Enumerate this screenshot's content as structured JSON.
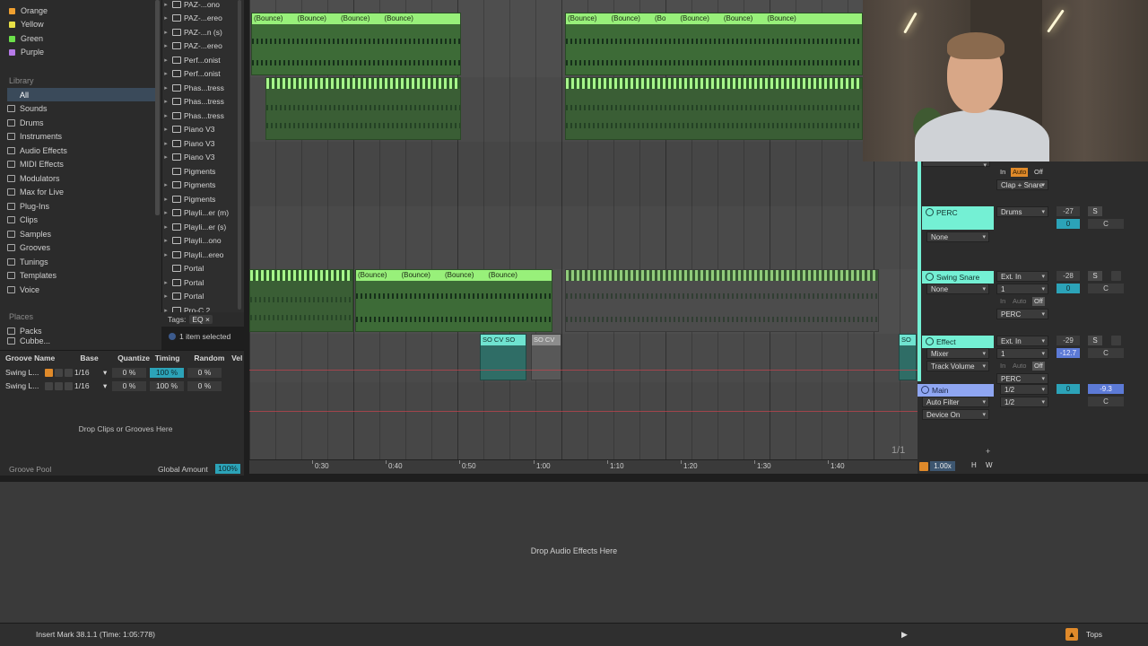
{
  "browser": {
    "colors": [
      {
        "label": "Orange",
        "color": "#f0a030"
      },
      {
        "label": "Yellow",
        "color": "#e8e046"
      },
      {
        "label": "Green",
        "color": "#6ce04a"
      },
      {
        "label": "Purple",
        "color": "#b67ae8"
      }
    ],
    "library_heading": "Library",
    "library": [
      "All",
      "Sounds",
      "Drums",
      "Instruments",
      "Audio Effects",
      "MIDI Effects",
      "Modulators",
      "Max for Live",
      "Plug-Ins",
      "Clips",
      "Samples",
      "Grooves",
      "Tunings",
      "Templates",
      "Voice"
    ],
    "places_heading": "Places",
    "places": [
      "Packs",
      "Cubbe..."
    ]
  },
  "files": [
    {
      "name": "PAZ-...ono",
      "arrow": "▸"
    },
    {
      "name": "PAZ-...ereo",
      "arrow": "▸"
    },
    {
      "name": "PAZ-...n (s)",
      "arrow": "▸"
    },
    {
      "name": "PAZ-...ereo",
      "arrow": "▸"
    },
    {
      "name": "Perf...onist",
      "arrow": "▸"
    },
    {
      "name": "Perf...onist",
      "arrow": "▸"
    },
    {
      "name": "Phas...tress",
      "arrow": "▸"
    },
    {
      "name": "Phas...tress",
      "arrow": "▸"
    },
    {
      "name": "Phas...tress",
      "arrow": "▸"
    },
    {
      "name": "Piano V3",
      "arrow": "▸"
    },
    {
      "name": "Piano V3",
      "arrow": "▸"
    },
    {
      "name": "Piano V3",
      "arrow": "▸"
    },
    {
      "name": "Pigments",
      "arrow": ""
    },
    {
      "name": "Pigments",
      "arrow": "▸"
    },
    {
      "name": "Pigments",
      "arrow": "▸"
    },
    {
      "name": "Playli...er (m)",
      "arrow": "▸"
    },
    {
      "name": "Playli...er (s)",
      "arrow": "▸"
    },
    {
      "name": "Playli...ono",
      "arrow": "▸"
    },
    {
      "name": "Playli...ereo",
      "arrow": "▸"
    },
    {
      "name": "Portal",
      "arrow": ""
    },
    {
      "name": "Portal",
      "arrow": "▸"
    },
    {
      "name": "Portal",
      "arrow": "▸"
    },
    {
      "name": "Pro-C 2",
      "arrow": "▸"
    }
  ],
  "tags": {
    "label": "Tags:",
    "chip": "EQ",
    "close": "×"
  },
  "selection": "1 item selected",
  "groove": {
    "columns": [
      "Groove Name",
      "Base",
      "Quantize",
      "Timing",
      "Random",
      "Vel"
    ],
    "rows": [
      {
        "name": "Swing L...",
        "base": "1/16",
        "quantize": "0 %",
        "timing": "100 %",
        "random": "0 %",
        "timing_highlight": true
      },
      {
        "name": "Swing L...",
        "base": "1/16",
        "quantize": "0 %",
        "timing": "100 %",
        "random": "0 %",
        "timing_highlight": false
      }
    ],
    "drop_hint": "Drop Clips or Grooves Here",
    "footer_title": "Groove Pool",
    "global_amount_label": "Global Amount",
    "global_amount": "100%"
  },
  "arrangement": {
    "bounce_label": "(Bounce)",
    "bounce_short": "(Bo",
    "clip_so": "SO",
    "clip_so_cv": "SO CV",
    "clip_so_cv_so": "SO CV  SO",
    "ratio": "1/1",
    "ruler": [
      "0:30",
      "0:40",
      "0:50",
      "1:00",
      "1:10",
      "1:20",
      "1:30",
      "1:40"
    ]
  },
  "mixer": {
    "top_labels": {
      "in": "In",
      "auto": "Auto",
      "off": "Off",
      "clap_snare": "Clap + Snare"
    },
    "perc": {
      "name": "PERC",
      "input": "Drums",
      "vol": "-27",
      "pan_val": "0",
      "pan": "C",
      "s": "S",
      "sub": "None"
    },
    "swing": {
      "name": "Swing Snare",
      "input": "Ext. In",
      "channel": "1",
      "vol": "-28",
      "pan_val": "0",
      "pan": "C",
      "s": "S",
      "sub": "None",
      "route": "PERC"
    },
    "effect": {
      "name": "Effect",
      "input": "Ext. In",
      "channel": "1",
      "vol": "-29",
      "pan_val": "-12.7",
      "pan": "C",
      "s": "S",
      "sub1": "Mixer",
      "sub2": "Track Volume",
      "route": "PERC"
    },
    "main": {
      "name": "Main",
      "out": "1/2",
      "out2": "1/2",
      "pan_val": "0",
      "vol": "-9.3",
      "pan": "C",
      "sub1": "Auto Filter",
      "sub2": "Device On"
    },
    "add": "+"
  },
  "transport": {
    "zoom": "1.00x",
    "h": "H",
    "w": "W"
  },
  "device": {
    "drop_hint": "Drop Audio Effects Here"
  },
  "status": {
    "text": "Insert Mark 38.1.1 (Time: 1:05:778)",
    "tops": "Tops",
    "play": "▶"
  },
  "colors": {
    "clip_green": "#98f07a",
    "teal": "#74f0d4",
    "accent_orange": "#e08a2a",
    "main_blue": "#8fa6f2"
  }
}
